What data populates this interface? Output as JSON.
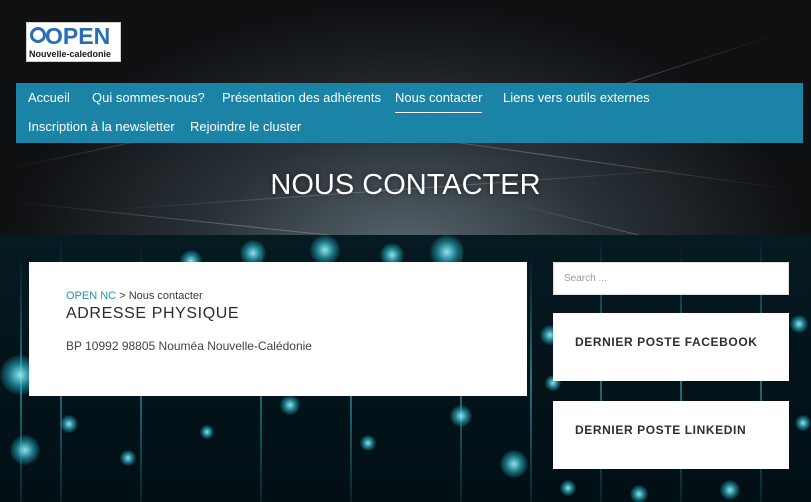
{
  "logo": {
    "word": "OPEN",
    "subtitle": "Nouvelle-caledonie"
  },
  "nav": {
    "items": [
      {
        "label": "Accueil"
      },
      {
        "label": "Qui sommes-nous?"
      },
      {
        "label": "Présentation des adhérents"
      },
      {
        "label": "Nous contacter",
        "active": true
      },
      {
        "label": "Liens vers outils externes"
      },
      {
        "label": "Inscription à la newsletter"
      },
      {
        "label": "Rejoindre le cluster"
      }
    ]
  },
  "page_title": "NOUS CONTACTER",
  "breadcrumb": {
    "home": "OPEN NC",
    "separator": ">",
    "current": "Nous contacter"
  },
  "address": {
    "title": "ADRESSE PHYSIQUE",
    "text": "BP 10992 98805 Nouméa Nouvelle-Calédonie"
  },
  "sidebar": {
    "search_placeholder": "Search ...",
    "widgets": [
      {
        "title": "DERNIER POSTE FACEBOOK"
      },
      {
        "title": "DERNIER POSTE LINKEDIN"
      }
    ]
  },
  "colors": {
    "nav_bg": "#1b84a6",
    "link": "#2a8fb8",
    "logo_blue": "#2a6db4"
  }
}
